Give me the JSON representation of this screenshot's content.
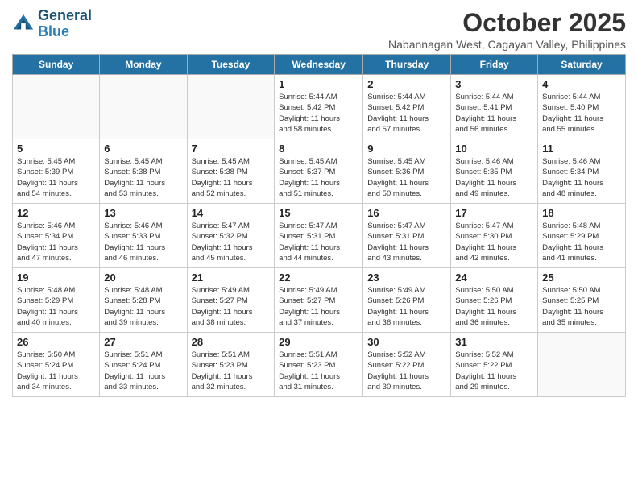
{
  "header": {
    "logo_line1": "General",
    "logo_line2": "Blue",
    "month_title": "October 2025",
    "subtitle": "Nabannagan West, Cagayan Valley, Philippines"
  },
  "days_of_week": [
    "Sunday",
    "Monday",
    "Tuesday",
    "Wednesday",
    "Thursday",
    "Friday",
    "Saturday"
  ],
  "weeks": [
    [
      {
        "day": "",
        "info": ""
      },
      {
        "day": "",
        "info": ""
      },
      {
        "day": "",
        "info": ""
      },
      {
        "day": "1",
        "info": "Sunrise: 5:44 AM\nSunset: 5:42 PM\nDaylight: 11 hours\nand 58 minutes."
      },
      {
        "day": "2",
        "info": "Sunrise: 5:44 AM\nSunset: 5:42 PM\nDaylight: 11 hours\nand 57 minutes."
      },
      {
        "day": "3",
        "info": "Sunrise: 5:44 AM\nSunset: 5:41 PM\nDaylight: 11 hours\nand 56 minutes."
      },
      {
        "day": "4",
        "info": "Sunrise: 5:44 AM\nSunset: 5:40 PM\nDaylight: 11 hours\nand 55 minutes."
      }
    ],
    [
      {
        "day": "5",
        "info": "Sunrise: 5:45 AM\nSunset: 5:39 PM\nDaylight: 11 hours\nand 54 minutes."
      },
      {
        "day": "6",
        "info": "Sunrise: 5:45 AM\nSunset: 5:38 PM\nDaylight: 11 hours\nand 53 minutes."
      },
      {
        "day": "7",
        "info": "Sunrise: 5:45 AM\nSunset: 5:38 PM\nDaylight: 11 hours\nand 52 minutes."
      },
      {
        "day": "8",
        "info": "Sunrise: 5:45 AM\nSunset: 5:37 PM\nDaylight: 11 hours\nand 51 minutes."
      },
      {
        "day": "9",
        "info": "Sunrise: 5:45 AM\nSunset: 5:36 PM\nDaylight: 11 hours\nand 50 minutes."
      },
      {
        "day": "10",
        "info": "Sunrise: 5:46 AM\nSunset: 5:35 PM\nDaylight: 11 hours\nand 49 minutes."
      },
      {
        "day": "11",
        "info": "Sunrise: 5:46 AM\nSunset: 5:34 PM\nDaylight: 11 hours\nand 48 minutes."
      }
    ],
    [
      {
        "day": "12",
        "info": "Sunrise: 5:46 AM\nSunset: 5:34 PM\nDaylight: 11 hours\nand 47 minutes."
      },
      {
        "day": "13",
        "info": "Sunrise: 5:46 AM\nSunset: 5:33 PM\nDaylight: 11 hours\nand 46 minutes."
      },
      {
        "day": "14",
        "info": "Sunrise: 5:47 AM\nSunset: 5:32 PM\nDaylight: 11 hours\nand 45 minutes."
      },
      {
        "day": "15",
        "info": "Sunrise: 5:47 AM\nSunset: 5:31 PM\nDaylight: 11 hours\nand 44 minutes."
      },
      {
        "day": "16",
        "info": "Sunrise: 5:47 AM\nSunset: 5:31 PM\nDaylight: 11 hours\nand 43 minutes."
      },
      {
        "day": "17",
        "info": "Sunrise: 5:47 AM\nSunset: 5:30 PM\nDaylight: 11 hours\nand 42 minutes."
      },
      {
        "day": "18",
        "info": "Sunrise: 5:48 AM\nSunset: 5:29 PM\nDaylight: 11 hours\nand 41 minutes."
      }
    ],
    [
      {
        "day": "19",
        "info": "Sunrise: 5:48 AM\nSunset: 5:29 PM\nDaylight: 11 hours\nand 40 minutes."
      },
      {
        "day": "20",
        "info": "Sunrise: 5:48 AM\nSunset: 5:28 PM\nDaylight: 11 hours\nand 39 minutes."
      },
      {
        "day": "21",
        "info": "Sunrise: 5:49 AM\nSunset: 5:27 PM\nDaylight: 11 hours\nand 38 minutes."
      },
      {
        "day": "22",
        "info": "Sunrise: 5:49 AM\nSunset: 5:27 PM\nDaylight: 11 hours\nand 37 minutes."
      },
      {
        "day": "23",
        "info": "Sunrise: 5:49 AM\nSunset: 5:26 PM\nDaylight: 11 hours\nand 36 minutes."
      },
      {
        "day": "24",
        "info": "Sunrise: 5:50 AM\nSunset: 5:26 PM\nDaylight: 11 hours\nand 36 minutes."
      },
      {
        "day": "25",
        "info": "Sunrise: 5:50 AM\nSunset: 5:25 PM\nDaylight: 11 hours\nand 35 minutes."
      }
    ],
    [
      {
        "day": "26",
        "info": "Sunrise: 5:50 AM\nSunset: 5:24 PM\nDaylight: 11 hours\nand 34 minutes."
      },
      {
        "day": "27",
        "info": "Sunrise: 5:51 AM\nSunset: 5:24 PM\nDaylight: 11 hours\nand 33 minutes."
      },
      {
        "day": "28",
        "info": "Sunrise: 5:51 AM\nSunset: 5:23 PM\nDaylight: 11 hours\nand 32 minutes."
      },
      {
        "day": "29",
        "info": "Sunrise: 5:51 AM\nSunset: 5:23 PM\nDaylight: 11 hours\nand 31 minutes."
      },
      {
        "day": "30",
        "info": "Sunrise: 5:52 AM\nSunset: 5:22 PM\nDaylight: 11 hours\nand 30 minutes."
      },
      {
        "day": "31",
        "info": "Sunrise: 5:52 AM\nSunset: 5:22 PM\nDaylight: 11 hours\nand 29 minutes."
      },
      {
        "day": "",
        "info": ""
      }
    ]
  ]
}
